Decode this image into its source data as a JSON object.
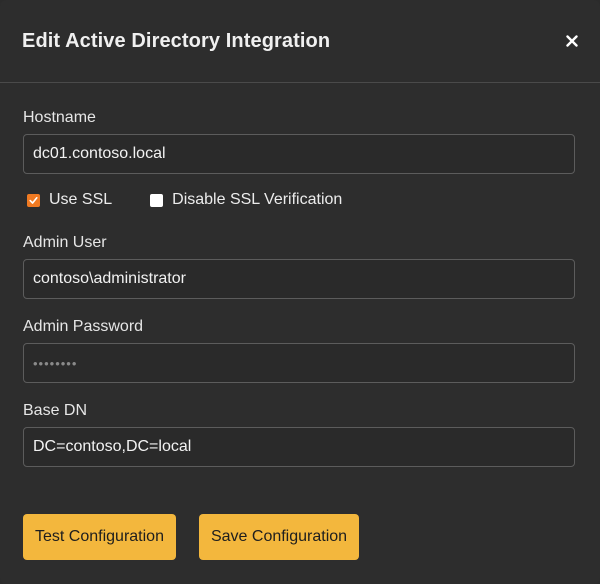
{
  "dialog": {
    "title": "Edit Active Directory Integration",
    "close_icon": "close-icon"
  },
  "fields": {
    "hostname": {
      "label": "Hostname",
      "value": "dc01.contoso.local"
    },
    "admin_user": {
      "label": "Admin User",
      "value": "contoso\\administrator"
    },
    "admin_password": {
      "label": "Admin Password",
      "value": "••••••••"
    },
    "base_dn": {
      "label": "Base DN",
      "value": "DC=contoso,DC=local"
    }
  },
  "options": {
    "use_ssl": {
      "label": "Use SSL",
      "checked": true
    },
    "disable_ssl_verification": {
      "label": "Disable SSL Verification",
      "checked": false
    }
  },
  "buttons": {
    "test": "Test Configuration",
    "save": "Save Configuration"
  },
  "colors": {
    "background": "#2d2d2d",
    "accent_button": "#f3b73d",
    "checkbox_checked": "#f07a22"
  }
}
